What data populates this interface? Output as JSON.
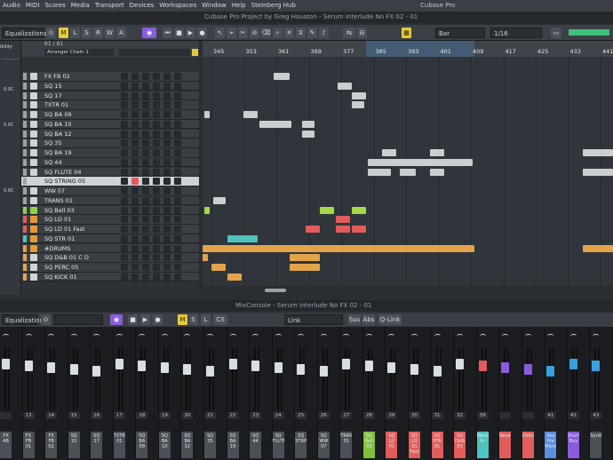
{
  "menubar": {
    "items": [
      "Audio",
      "MIDI",
      "Scores",
      "Media",
      "Transport",
      "Devices",
      "Workspaces",
      "Window",
      "Help",
      "Steinberg Hub"
    ],
    "app_title": "Cubase Pro"
  },
  "project_title": "Cubase Pro Project by Greg Houston - Serum Interlude No FX 02 - 01",
  "toolbar": {
    "left_dropdown": "Equalizations",
    "buttons": [
      "M",
      "L",
      "S",
      "R",
      "W",
      "A"
    ],
    "grid_mode": "Bar",
    "quantize": "1/16"
  },
  "track_panel": {
    "count_label": "61 / 61",
    "chain_label": "Arranger Chain 1"
  },
  "tracks": [
    {
      "name": "FX FB 02",
      "color": "#9aa2a9",
      "icon": "gray"
    },
    {
      "name": "SQ 15",
      "color": "#9aa2a9",
      "icon": "gray"
    },
    {
      "name": "SQ 17",
      "color": "#9aa2a9",
      "icon": "gray"
    },
    {
      "name": "TXTR 01",
      "color": "#9aa2a9",
      "icon": "gray"
    },
    {
      "name": "SQ BA 09",
      "color": "#9aa2a9",
      "icon": "gray"
    },
    {
      "name": "SQ BA 10",
      "color": "#9aa2a9",
      "icon": "gray"
    },
    {
      "name": "SQ BA 12",
      "color": "#9aa2a9",
      "icon": "gray"
    },
    {
      "name": "SQ 35",
      "color": "#9aa2a9",
      "icon": "gray"
    },
    {
      "name": "SQ BA 19",
      "color": "#9aa2a9",
      "icon": "gray"
    },
    {
      "name": "SQ 44",
      "color": "#9aa2a9",
      "icon": "gray"
    },
    {
      "name": "SQ FLUTE 04",
      "color": "#9aa2a9",
      "icon": "gray"
    },
    {
      "name": "SQ STRING 05",
      "color": "#9aa2a9",
      "icon": "gray",
      "selected": true
    },
    {
      "name": "WW 07",
      "color": "#9aa2a9",
      "icon": "gray"
    },
    {
      "name": "TRANS 01",
      "color": "#9aa2a9",
      "icon": "gray"
    },
    {
      "name": "SQ Bell 03",
      "color": "#8ed14a",
      "icon": "green"
    },
    {
      "name": "SQ LD 01",
      "color": "#e35c5c",
      "icon": "orange"
    },
    {
      "name": "SQ LD 01 Fast",
      "color": "#e35c5c",
      "icon": "orange"
    },
    {
      "name": "SQ STR 01",
      "color": "#4fc3bd",
      "icon": "orange"
    },
    {
      "name": "#DRUMS",
      "color": "#e3a34a",
      "icon": "orange"
    },
    {
      "name": "SQ D&B 01 C D",
      "color": "#e3a34a",
      "icon": "gray"
    },
    {
      "name": "SQ PERC 05",
      "color": "#e3a34a",
      "icon": "gray"
    },
    {
      "name": "SQ KICK 01",
      "color": "#e3a34a",
      "icon": "gray"
    }
  ],
  "ruler": {
    "labels": [
      "345",
      "353",
      "361",
      "369",
      "377",
      "385",
      "393",
      "401",
      "409",
      "417",
      "425",
      "433",
      "441"
    ]
  },
  "mixconsole": {
    "title": "MixConsole - Serum Interlude No FX 02 - 01",
    "left_dropdown": "Equalizations",
    "link_label": "Link",
    "buttons": [
      "Sus",
      "Abs",
      "Q-Link"
    ],
    "channels": [
      {
        "num": "",
        "label": "FX AB",
        "color": "#4a5057",
        "fader": "#d8dde2"
      },
      {
        "num": "13",
        "label": "FX FB 01",
        "color": "#4a5057",
        "fader": "#d8dde2"
      },
      {
        "num": "14",
        "label": "FX FB 02",
        "color": "#4a5057",
        "fader": "#d8dde2"
      },
      {
        "num": "15",
        "label": "SQ 15",
        "color": "#4a5057",
        "fader": "#d8dde2"
      },
      {
        "num": "16",
        "label": "SQ 17",
        "color": "#4a5057",
        "fader": "#d8dde2"
      },
      {
        "num": "17",
        "label": "TXTR 01",
        "color": "#4a5057",
        "fader": "#d8dde2"
      },
      {
        "num": "18",
        "label": "SQ BA 09",
        "color": "#4a5057",
        "fader": "#d8dde2"
      },
      {
        "num": "19",
        "label": "SQ BA 10",
        "color": "#4a5057",
        "fader": "#d8dde2"
      },
      {
        "num": "20",
        "label": "SQ BA 12",
        "color": "#4a5057",
        "fader": "#d8dde2"
      },
      {
        "num": "21",
        "label": "SQ 35",
        "color": "#4a5057",
        "fader": "#d8dde2"
      },
      {
        "num": "22",
        "label": "SQ BA 19",
        "color": "#4a5057",
        "fader": "#d8dde2"
      },
      {
        "num": "23",
        "label": "SQ 44",
        "color": "#4a5057",
        "fader": "#d8dde2"
      },
      {
        "num": "24",
        "label": "SQ FLUTE",
        "color": "#4a5057",
        "fader": "#d8dde2"
      },
      {
        "num": "25",
        "label": "SQ STRING",
        "color": "#4a5057",
        "fader": "#d8dde2"
      },
      {
        "num": "26",
        "label": "SQ WW 07",
        "color": "#4a5057",
        "fader": "#d8dde2"
      },
      {
        "num": "27",
        "label": "TRANS 01",
        "color": "#4a5057",
        "fader": "#d8dde2"
      },
      {
        "num": "28",
        "label": "SQ Bell 03",
        "color": "#7fc23a",
        "fader": "#d8dde2"
      },
      {
        "num": "29",
        "label": "SQ LD 01",
        "color": "#e35c5c",
        "fader": "#d8dde2"
      },
      {
        "num": "30",
        "label": "SQ LD 01 Fast",
        "color": "#e35c5c",
        "fader": "#d8dde2"
      },
      {
        "num": "31",
        "label": "SQ STR 01",
        "color": "#e35c5c",
        "fader": "#d8dde2"
      },
      {
        "num": "32",
        "label": "SQ D&B 01",
        "color": "#e35c5c",
        "fader": "#d8dde2"
      },
      {
        "num": "39",
        "label": "Mono In",
        "color": "#4fc3bd",
        "fader": "#e35c5c"
      },
      {
        "num": "",
        "label": "Reverb",
        "color": "#e35c5c",
        "fader": "#8a5cdc"
      },
      {
        "num": "",
        "label": "Distortion",
        "color": "#e35c5c",
        "fader": "#8a5cdc"
      },
      {
        "num": "41",
        "label": "Vox Pre Mono",
        "color": "#5b8fe0",
        "fader": "#3aa0e0"
      },
      {
        "num": "42",
        "label": "Drum Bus",
        "color": "#8a5cdc",
        "fader": "#3aa0e0"
      },
      {
        "num": "43",
        "label": "Synth",
        "color": "#4a5057",
        "fader": "#3aa0e0"
      }
    ]
  }
}
